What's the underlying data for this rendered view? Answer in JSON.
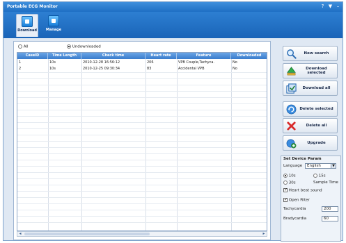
{
  "window": {
    "title": "Portable ECG Monitor",
    "help": "?",
    "menu": "▼",
    "minimize": "–"
  },
  "toolbar": {
    "tabs": [
      {
        "label": "Download",
        "active": true
      },
      {
        "label": "Manage",
        "active": false
      }
    ]
  },
  "filters": {
    "all": "All",
    "undownloaded": "Undownloaded",
    "selected": "undownloaded"
  },
  "table": {
    "columns": [
      "CaseID",
      "Time Length",
      "Check time",
      "Heart rate",
      "Feature",
      "Downloaded"
    ],
    "rows": [
      [
        "1",
        "10s",
        "2010-12-28 16:56:12",
        "206",
        "VPB Couple,Tachyca.",
        "No"
      ],
      [
        "2",
        "10s",
        "2010-12-25 09:30:34",
        "83",
        "Accidental VPB",
        "No"
      ]
    ]
  },
  "actions": {
    "new_search": "New search",
    "download_selected": "Download selected",
    "download_all": "Download all",
    "delete_selected": "Delete selected",
    "delete_all": "Delete all",
    "upgrade": "Upgrade"
  },
  "device_params": {
    "title": "Set Device Param",
    "language_label": "Language",
    "language_value": "English",
    "sample_10s": "10s",
    "sample_15s": "15s",
    "sample_30s": "30s",
    "sample_time_label": "Sample Time",
    "heart_beat_sound": "Heart beat sound",
    "open_filter": "Open Filter",
    "tachycardia_label": "Tachycardia",
    "tachycardia_value": "200",
    "bradycardia_label": "Bradycardia",
    "bradycardia_value": "60"
  },
  "colors": {
    "accent": "#1e6fc4",
    "header": "#3a7ccc",
    "panel": "#dfe8f3"
  }
}
